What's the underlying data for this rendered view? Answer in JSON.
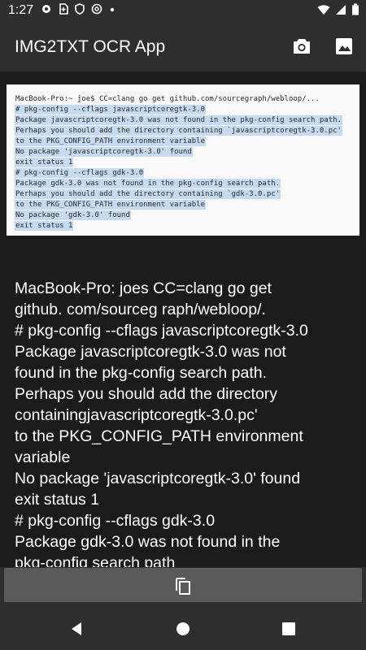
{
  "status_bar": {
    "time": "1:27",
    "icons_left": [
      "gear-icon",
      "sim-icon",
      "shield-icon",
      "at-icon",
      "dot-icon"
    ],
    "icons_right": [
      "wifi-icon",
      "signal-icon",
      "battery-icon"
    ]
  },
  "app_bar": {
    "title": "IMG2TXT OCR App",
    "actions": [
      "camera-icon",
      "image-icon"
    ]
  },
  "ocr_image_lines": [
    "MacBook-Pro:~ joe$ CC=clang go get github.com/sourcegraph/webloop/...",
    "# pkg-config --cflags javascriptcoregtk-3.0",
    "Package javascriptcoregtk-3.0 was not found in the pkg-config search path.",
    "Perhaps you should add the directory containing `javascriptcoregtk-3.0.pc'",
    "to the PKG_CONFIG_PATH environment variable",
    "No package 'javascriptcoregtk-3.0' found",
    "exit status 1",
    "# pkg-config --cflags gdk-3.0",
    "Package gdk-3.0 was not found in the pkg-config search path.",
    "Perhaps you should add the directory containing `gdk-3.0.pc'",
    "to the PKG_CONFIG_PATH environment variable",
    "No package 'gdk-3.0' found",
    "exit status 1"
  ],
  "result_lines": [
    "MacBook-Pro: joes CC=clang go get",
    "github. com/sourceg raph/webloop/.",
    "# pkg-config --cflags javascriptcoregtk-3.0",
    "Package javascriptcoregtk-3.0 was not",
    "found in the pkg-config search path.",
    "Perhaps you should add the directory",
    "containingjavascriptcoregtk-3.0.pc'",
    "to the PKG_CONFIG_PATH environment",
    "variable",
    "No package 'javascriptcoregtk-3.0' found",
    "exit status 1",
    "# pkg-config --cflags gdk-3.0",
    "Package gdk-3.0 was not found in the",
    "pkg-config search path"
  ],
  "copy_bar": {
    "icon": "copy-icon"
  },
  "nav_bar": {
    "buttons": [
      "back-icon",
      "home-icon",
      "recents-icon"
    ]
  }
}
